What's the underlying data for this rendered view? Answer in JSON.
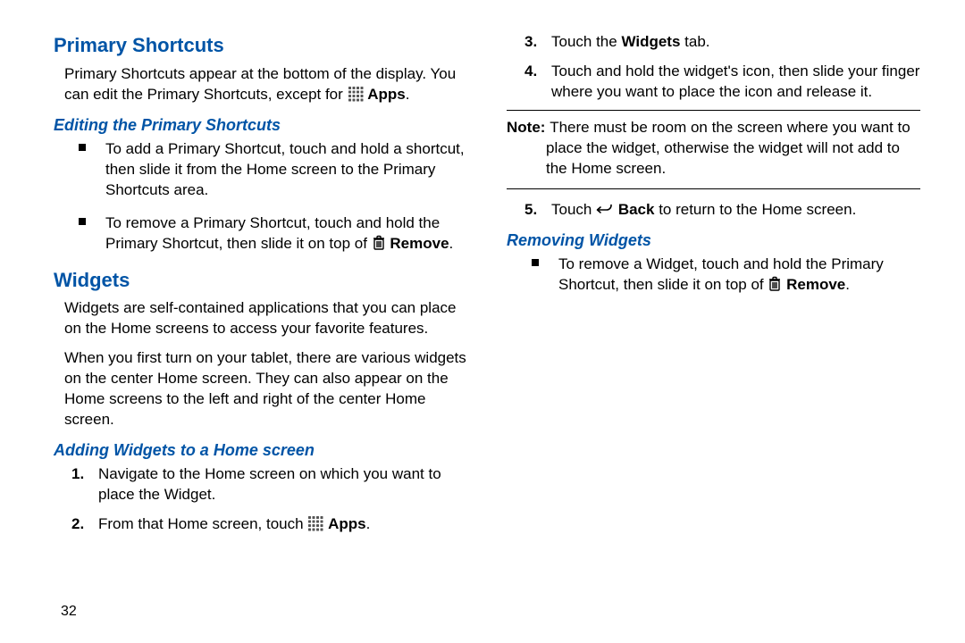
{
  "pageNumber": "32",
  "left": {
    "h1": "Primary Shortcuts",
    "p1_a": "Primary Shortcuts appear at the bottom of the display. You can edit the Primary Shortcuts, except for ",
    "p1_apps": "Apps",
    "p1_b": ".",
    "h2": "Editing the Primary Shortcuts",
    "bullet1": "To add a Primary Shortcut, touch and hold a shortcut, then slide it from the Home screen to the Primary Shortcuts area.",
    "bullet2_a": "To remove a Primary Shortcut, touch and hold the Primary Shortcut, then slide it on top of ",
    "bullet2_remove": "Remove",
    "bullet2_b": ".",
    "h3": "Widgets",
    "p2": "Widgets are self-contained applications that you can place on the Home screens to access your favorite features.",
    "p3": "When you first turn on your tablet, there are various widgets on the center Home screen. They can also appear on the Home screens to the left and right of the center Home screen."
  },
  "right": {
    "h1": "Adding Widgets to a Home screen",
    "s1": "Navigate to the Home screen on which you want to place the Widget.",
    "s2_a": "From that Home screen, touch ",
    "s2_apps": "Apps",
    "s2_b": ".",
    "s3_a": "Touch the ",
    "s3_tab": "Widgets",
    "s3_b": " tab.",
    "s4": "Touch and hold the widget's icon, then slide your finger where you want to place the icon and release it.",
    "note_label": "Note:",
    "note_body": "There must be room on the screen where you want to place the widget, otherwise the widget will not add to the Home screen.",
    "s5_a": "Touch ",
    "s5_back": "Back",
    "s5_b": " to return to the Home screen.",
    "h2": "Removing Widgets",
    "rb_a": "To remove a Widget, touch and hold the Primary Shortcut, then slide it on top of ",
    "rb_remove": "Remove",
    "rb_b": "."
  }
}
